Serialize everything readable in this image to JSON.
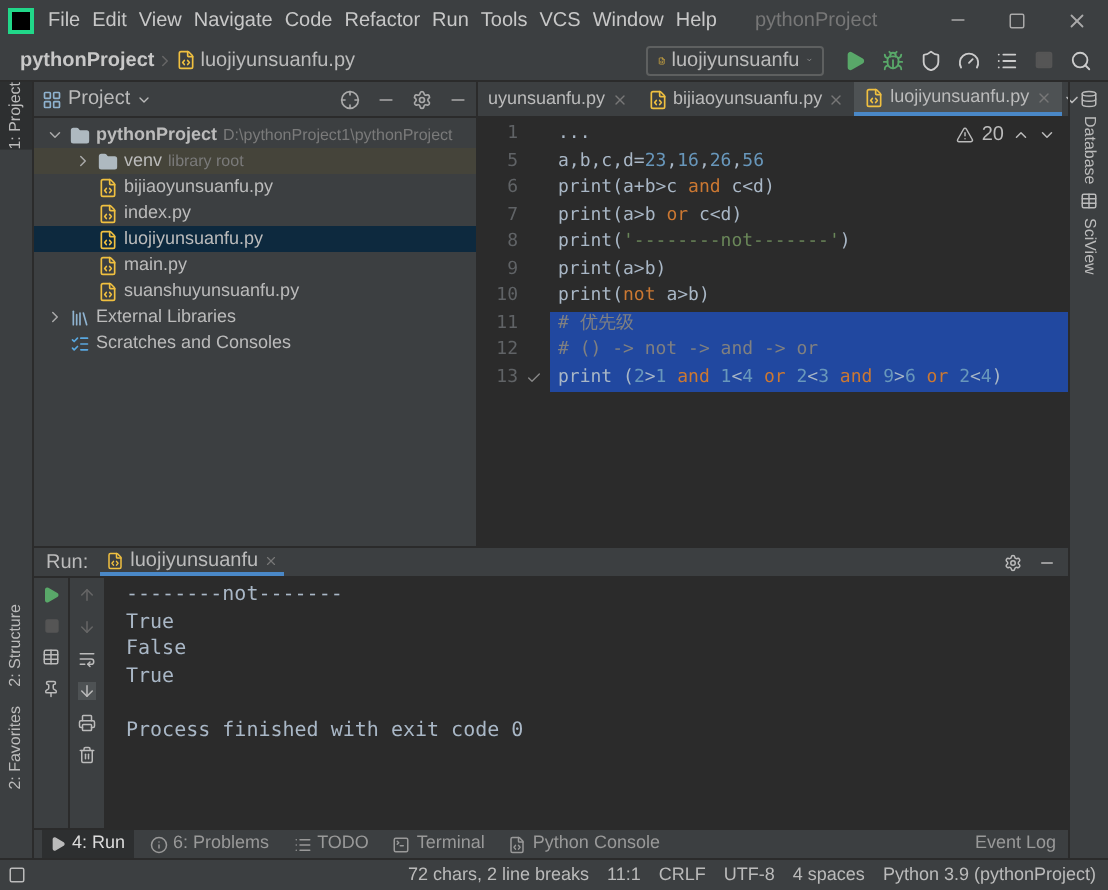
{
  "menu_bar": {
    "items": [
      "File",
      "Edit",
      "View",
      "Navigate",
      "Code",
      "Refactor",
      "Run",
      "Tools",
      "VCS",
      "Window",
      "Help"
    ],
    "title": "pythonProject"
  },
  "nav_bar": {
    "breadcrumbs": [
      "pythonProject",
      "luojiyunsuanfu.py"
    ],
    "run_config": "luojiyunsuanfu"
  },
  "left_stripe": [
    "1: Project",
    "2: Structure",
    "2: Favorites"
  ],
  "right_stripe": [
    "Database",
    "SciView"
  ],
  "project_panel": {
    "title": "Project",
    "tree": [
      {
        "label": "pythonProject",
        "hint": "D:\\pythonProject1\\pythonProject",
        "kind": "folder",
        "expanded": true,
        "selected": false,
        "children": [
          {
            "label": "venv",
            "hint": "library root",
            "kind": "folder",
            "expanded": false,
            "selected": false
          },
          {
            "label": "bijiaoyunsuanfu.py",
            "kind": "file",
            "selected": false
          },
          {
            "label": "index.py",
            "kind": "file",
            "selected": false
          },
          {
            "label": "luojiyunsuanfu.py",
            "kind": "file",
            "selected": true
          },
          {
            "label": "main.py",
            "kind": "file",
            "selected": false
          },
          {
            "label": "suanshuyunsuanfu.py",
            "kind": "file",
            "selected": false
          }
        ]
      },
      {
        "label": "External Libraries",
        "kind": "libraries",
        "expanded": false,
        "selected": false
      },
      {
        "label": "Scratches and Consoles",
        "kind": "scratches",
        "selected": false
      }
    ]
  },
  "editor": {
    "tabs": [
      {
        "label": "uyunsuanfu.py",
        "selected": false
      },
      {
        "label": "bijiaoyunsuanfu.py",
        "selected": false
      },
      {
        "label": "luojiyunsuanfu.py",
        "selected": true
      }
    ],
    "warnings": "20",
    "lines": [
      {
        "number": "1",
        "selected": false,
        "tokens": [
          {
            "kind": "plain",
            "text": "..."
          }
        ]
      },
      {
        "number": "5",
        "selected": false,
        "tokens": [
          {
            "kind": "plain",
            "text": "a,b,c,d="
          },
          {
            "kind": "number_list",
            "text": "23,16,26,56"
          }
        ]
      },
      {
        "number": "6",
        "selected": false,
        "tokens": [
          {
            "kind": "plain",
            "text": "print(a+b>c "
          },
          {
            "kind": "keyword",
            "text": "and"
          },
          {
            "kind": "plain",
            "text": " c<d)"
          }
        ]
      },
      {
        "number": "7",
        "selected": false,
        "tokens": [
          {
            "kind": "plain",
            "text": "print(a>b "
          },
          {
            "kind": "keyword",
            "text": "or"
          },
          {
            "kind": "plain",
            "text": " c<d)"
          }
        ]
      },
      {
        "number": "8",
        "selected": false,
        "tokens": [
          {
            "kind": "plain",
            "text": "print("
          },
          {
            "kind": "string",
            "text": "'--------not-------'"
          },
          {
            "kind": "plain",
            "text": ")"
          }
        ]
      },
      {
        "number": "9",
        "selected": false,
        "tokens": [
          {
            "kind": "plain",
            "text": "print(a>b)"
          }
        ]
      },
      {
        "number": "10",
        "selected": false,
        "tokens": [
          {
            "kind": "plain",
            "text": "print("
          },
          {
            "kind": "keyword",
            "text": "not"
          },
          {
            "kind": "plain",
            "text": " a>b)"
          }
        ]
      },
      {
        "number": "11",
        "selected": true,
        "tokens": [
          {
            "kind": "comment",
            "text": "# 优先级"
          }
        ]
      },
      {
        "number": "12",
        "selected": true,
        "tokens": [
          {
            "kind": "comment",
            "text": "# () -> not -> and -> or"
          }
        ]
      },
      {
        "number": "13",
        "selected": true,
        "tokens": [
          {
            "kind": "plain",
            "text": "print ("
          },
          {
            "kind": "number",
            "text": "2"
          },
          {
            "kind": "plain",
            "text": ">"
          },
          {
            "kind": "number",
            "text": "1"
          },
          {
            "kind": "keyword",
            "text": " and "
          },
          {
            "kind": "number",
            "text": "1"
          },
          {
            "kind": "plain",
            "text": "<"
          },
          {
            "kind": "number",
            "text": "4"
          },
          {
            "kind": "keyword",
            "text": " or "
          },
          {
            "kind": "number",
            "text": "2"
          },
          {
            "kind": "plain",
            "text": "<"
          },
          {
            "kind": "number",
            "text": "3"
          },
          {
            "kind": "keyword",
            "text": " and "
          },
          {
            "kind": "number",
            "text": "9"
          },
          {
            "kind": "plain",
            "text": ">"
          },
          {
            "kind": "number",
            "text": "6"
          },
          {
            "kind": "keyword",
            "text": " or "
          },
          {
            "kind": "number",
            "text": "2"
          },
          {
            "kind": "plain",
            "text": "<"
          },
          {
            "kind": "number",
            "text": "4"
          },
          {
            "kind": "plain",
            "text": ")"
          }
        ]
      }
    ]
  },
  "run_panel": {
    "label": "Run:",
    "tab": "luojiyunsuanfu",
    "output": [
      {
        "kind": "text",
        "text": "--------not-------"
      },
      {
        "kind": "text",
        "text": "True"
      },
      {
        "kind": "text",
        "text": "False"
      },
      {
        "kind": "text",
        "text": "True"
      },
      {
        "kind": "exit",
        "text": "Process finished with exit code 0"
      }
    ]
  },
  "tool_tabs": [
    {
      "label": "4: Run",
      "kind": "run",
      "selected": true
    },
    {
      "label": "6: Problems",
      "kind": "problems",
      "selected": false
    },
    {
      "label": "TODO",
      "kind": "todo",
      "selected": false
    },
    {
      "label": "Terminal",
      "kind": "terminal",
      "selected": false
    },
    {
      "label": "Python Console",
      "kind": "console",
      "selected": false
    }
  ],
  "event_log": "Event Log",
  "status_bar": [
    "72 chars, 2 line breaks",
    "11:1",
    "CRLF",
    "UTF-8",
    "4 spaces",
    "Python 3.9 (pythonProject)"
  ]
}
